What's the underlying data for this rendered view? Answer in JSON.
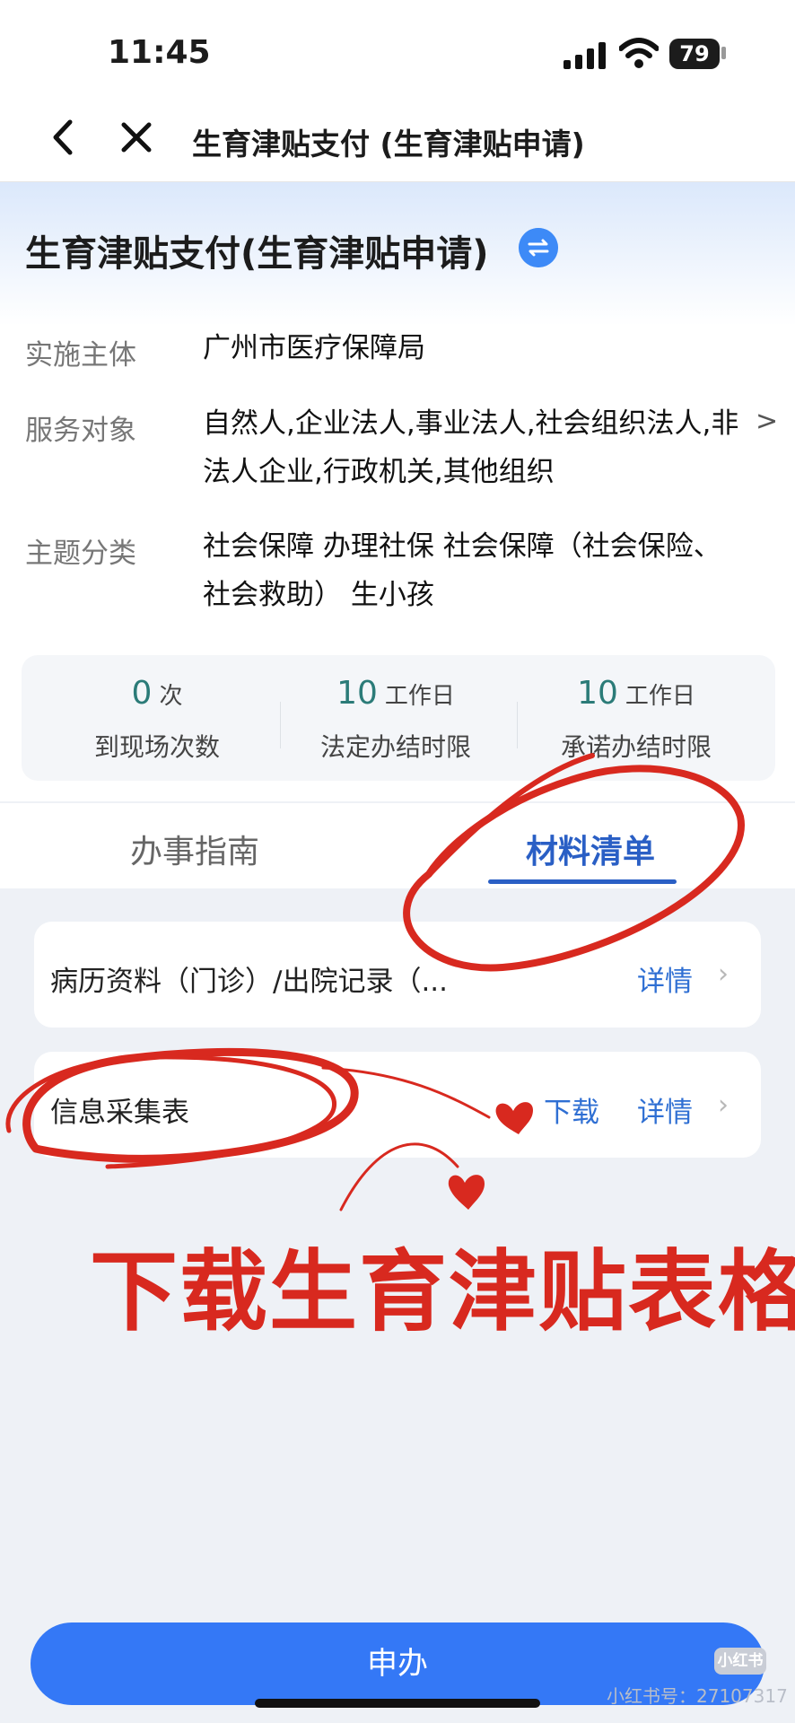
{
  "status_bar": {
    "time": "11:45",
    "battery": "79"
  },
  "nav": {
    "title": "生育津贴支付 (生育津贴申请)"
  },
  "header": {
    "title": "生育津贴支付(生育津贴申请)",
    "rows": [
      {
        "label": "实施主体",
        "value": "广州市医疗保障局"
      },
      {
        "label": "服务对象",
        "value": "自然人,企业法人,事业法人,社会组织法人,非法人企业,行政机关,其他组织"
      },
      {
        "label": "主题分类",
        "value": "社会保障 办理社保 社会保障（社会保险、社会救助） 生小孩"
      }
    ]
  },
  "stats": [
    {
      "number": "0",
      "unit": "次",
      "caption": "到现场次数"
    },
    {
      "number": "10",
      "unit": "工作日",
      "caption": "法定办结时限"
    },
    {
      "number": "10",
      "unit": "工作日",
      "caption": "承诺办结时限"
    }
  ],
  "tabs": [
    {
      "label": "办事指南",
      "active": false
    },
    {
      "label": "材料清单",
      "active": true
    }
  ],
  "materials": [
    {
      "label": "病历资料（门诊）/出院记录（...",
      "details": "详情"
    },
    {
      "label": "信息采集表",
      "download": "下载",
      "details": "详情"
    }
  ],
  "annotation": {
    "text": "下载生育津贴表格",
    "color": "#d8291f"
  },
  "apply_button": "申办",
  "watermark": {
    "badge": "小红书",
    "text": "小红书号：27107317"
  },
  "colors": {
    "accent": "#3478f6",
    "stat_number": "#2b7b78",
    "link": "#2f6fd3"
  }
}
